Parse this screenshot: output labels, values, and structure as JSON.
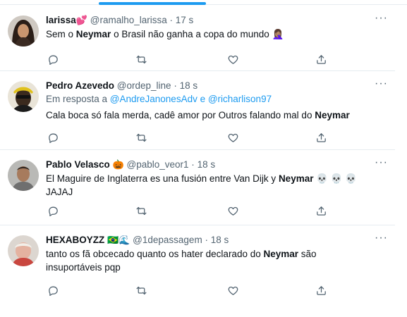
{
  "tweets": [
    {
      "name": "larissa",
      "name_emoji": "💕",
      "handle": "@ramalho_larissa",
      "dot": "·",
      "time": "17 s",
      "text_before": "Sem o ",
      "highlight": "Neymar",
      "text_after": " o Brasil não ganha a copa do mundo 🤦🏽‍♀️"
    },
    {
      "name": "Pedro Azevedo",
      "handle": "@ordep_line",
      "dot": "·",
      "time": "18 s",
      "reply_prefix": "Em resposta a ",
      "reply_user1": "@AndreJanonesAdv",
      "reply_and": " e ",
      "reply_user2": "@richarlison97",
      "text_before": "Cala boca só fala merda, cadê amor por Outros falando mal do ",
      "highlight": "Neymar",
      "text_after": ""
    },
    {
      "name": "Pablo Velasco",
      "name_emoji": "🎃",
      "handle": "@pablo_veor1",
      "dot": "·",
      "time": "18 s",
      "text_before": "El Maguire de Inglaterra es una fusión entre Van Dijk y ",
      "highlight": "Neymar",
      "text_after": " 💀 💀 💀",
      "text_line2": "JAJAJ"
    },
    {
      "name": "HEXABOYZZ",
      "name_emoji": "🇧🇷🌊",
      "handle": "@1depassagem",
      "dot": "·",
      "time": "18 s",
      "text_before": "tanto os fã obcecado quanto os hater declarado do ",
      "highlight": "Neymar",
      "text_after": " são",
      "text_line2": "insuportáveis pqp"
    }
  ],
  "ui": {
    "more": "···",
    "accent": "#1d9bf0",
    "icon_color": "#536471",
    "action_icons": [
      "reply-icon",
      "retweet-icon",
      "like-icon",
      "share-icon"
    ]
  }
}
